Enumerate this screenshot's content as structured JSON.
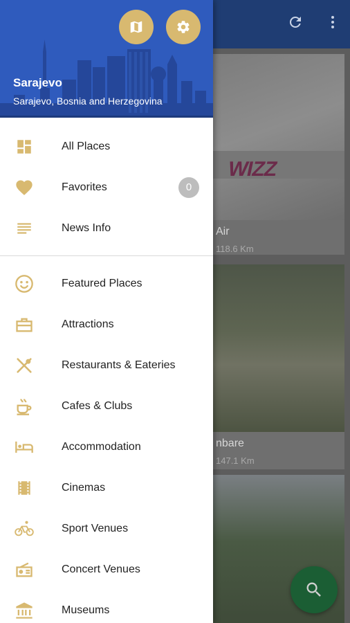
{
  "colors": {
    "accent": "#d8b970",
    "header_bg": "#2f5bbd",
    "app_bar": "#1f3d73",
    "fab": "#1b5e34",
    "badge": "#bdbdbd"
  },
  "app_bar": {
    "refresh_icon": "refresh-icon",
    "more_icon": "more-vert-icon"
  },
  "cards": [
    {
      "title": "Air",
      "distance": "118.6 Km",
      "logo": "WIZZ"
    },
    {
      "title": "nbare",
      "distance": "147.1 Km"
    },
    {
      "title": "",
      "distance": ""
    }
  ],
  "drawer": {
    "header": {
      "city": "Sarajevo",
      "location": "Sarajevo, Bosnia and Herzegovina",
      "map_icon": "map-icon",
      "settings_icon": "gear-icon"
    },
    "group1": [
      {
        "label": "All Places",
        "icon": "dashboard-icon"
      },
      {
        "label": "Favorites",
        "icon": "heart-icon",
        "badge": "0"
      },
      {
        "label": "News Info",
        "icon": "news-icon"
      }
    ],
    "group2": [
      {
        "label": "Featured Places",
        "icon": "smiley-icon"
      },
      {
        "label": "Attractions",
        "icon": "briefcase-icon"
      },
      {
        "label": "Restaurants & Eateries",
        "icon": "utensils-icon"
      },
      {
        "label": "Cafes & Clubs",
        "icon": "coffee-icon"
      },
      {
        "label": "Accommodation",
        "icon": "bed-icon"
      },
      {
        "label": "Cinemas",
        "icon": "film-icon"
      },
      {
        "label": "Sport Venues",
        "icon": "bicycle-icon"
      },
      {
        "label": "Concert Venues",
        "icon": "radio-icon"
      },
      {
        "label": "Museums",
        "icon": "museum-icon"
      }
    ]
  },
  "fab": {
    "icon": "search-icon"
  }
}
